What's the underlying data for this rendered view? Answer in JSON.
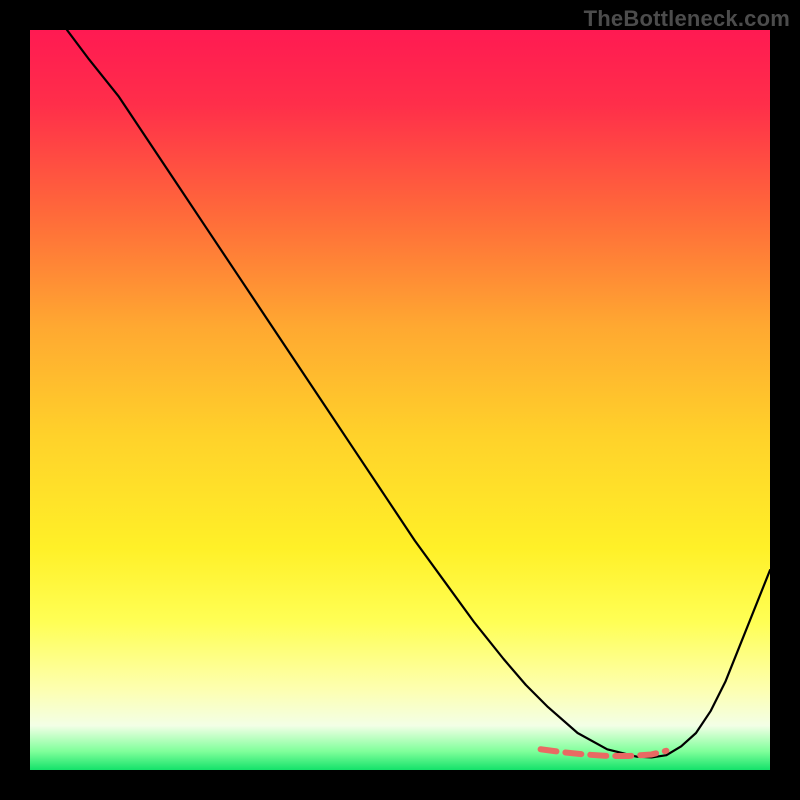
{
  "watermark": {
    "text": "TheBottleneck.com"
  },
  "chart_data": {
    "type": "line",
    "title": "",
    "xlabel": "",
    "ylabel": "",
    "xlim": [
      0,
      100
    ],
    "ylim": [
      0,
      100
    ],
    "background": {
      "gradient_stops": [
        {
          "offset": 0.0,
          "color": "#ff1a52"
        },
        {
          "offset": 0.1,
          "color": "#ff2e4a"
        },
        {
          "offset": 0.25,
          "color": "#ff6a3a"
        },
        {
          "offset": 0.4,
          "color": "#ffa831"
        },
        {
          "offset": 0.55,
          "color": "#ffd22a"
        },
        {
          "offset": 0.7,
          "color": "#fff028"
        },
        {
          "offset": 0.8,
          "color": "#ffff55"
        },
        {
          "offset": 0.89,
          "color": "#fdffaf"
        },
        {
          "offset": 0.94,
          "color": "#f3ffe6"
        },
        {
          "offset": 0.975,
          "color": "#7fff9a"
        },
        {
          "offset": 1.0,
          "color": "#14e26a"
        }
      ]
    },
    "series": [
      {
        "name": "bottleneck-curve",
        "color": "#000000",
        "stroke_width": 2.2,
        "x": [
          5,
          8,
          12,
          16,
          20,
          24,
          28,
          32,
          36,
          40,
          44,
          48,
          52,
          56,
          60,
          64,
          67,
          70,
          74,
          78,
          82,
          84,
          86,
          88,
          90,
          92,
          94,
          96,
          100
        ],
        "y": [
          100,
          96,
          91,
          85,
          79,
          73,
          67,
          61,
          55,
          49,
          43,
          37,
          31,
          25.5,
          20,
          15,
          11.5,
          8.5,
          5,
          2.8,
          1.8,
          1.7,
          2.0,
          3.2,
          5.0,
          8.0,
          12,
          17,
          27
        ]
      },
      {
        "name": "optimal-range",
        "color": "#e96a63",
        "stroke_width": 6,
        "dash": "16 9",
        "x": [
          69,
          72,
          75,
          78,
          81,
          84,
          86
        ],
        "y": [
          2.8,
          2.4,
          2.1,
          1.9,
          1.9,
          2.1,
          2.6
        ]
      }
    ]
  }
}
